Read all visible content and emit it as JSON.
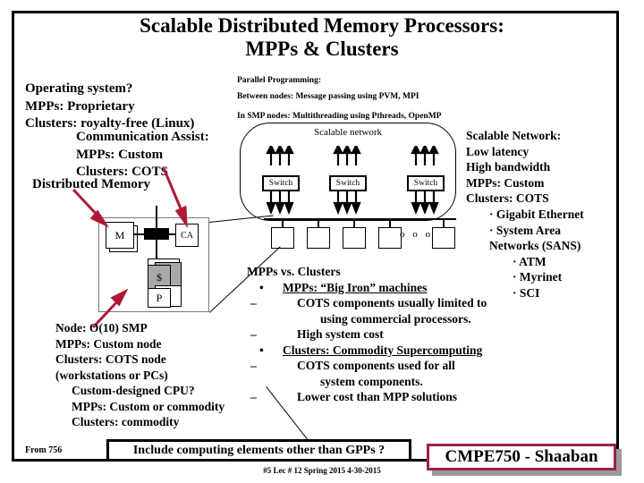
{
  "slide": {
    "title_line1": "Scalable Distributed Memory Processors:",
    "title_line2": "MPPs & Clusters"
  },
  "os_block": {
    "l1": "Operating system?",
    "l2": "MPPs: Proprietary",
    "l3": "Clusters:  royalty-free (Linux)"
  },
  "comm_assist": {
    "l1": "Communication Assist:",
    "l2": "MPPs:  Custom",
    "l3": "Clusters:  COTS"
  },
  "distributed_memory": {
    "label": "Distributed Memory"
  },
  "parallel_programming": {
    "heading": "Parallel Programming:",
    "between_nodes": "Between nodes: Message passing using PVM, MPI",
    "in_smp_nodes": "In SMP nodes:  Multithreading using Pthreads,  OpenMP"
  },
  "network_diagram": {
    "label": "Scalable network",
    "switch_label": "Switch",
    "switches": [
      "Switch",
      "Switch",
      "Switch"
    ],
    "ellipsis": "o  o  o"
  },
  "node_diagram": {
    "memory": "M",
    "comm_assist": "CA",
    "cache": "$",
    "processor": "P"
  },
  "scalable_network_block": {
    "l1": "Scalable Network:",
    "l2": "Low latency",
    "l3": "High bandwidth",
    "l4": "MPPs:  Custom",
    "l5": "Clusters:  COTS",
    "l6": "· Gigabit Ethernet",
    "l7": "· System Area",
    "l8": "Networks (SANS)",
    "l9": "· ATM",
    "l10": "· Myrinet",
    "l11": "· SCI"
  },
  "node_text": {
    "l1": "Node: O(10) SMP",
    "l2": "MPPs:  Custom node",
    "l3": "Clusters:  COTS node",
    "l4": "(workstations or PCs)"
  },
  "cpu_text": {
    "l1": "Custom-designed CPU?",
    "l2": "MPPs:   Custom or commodity",
    "l3": "Clusters:  commodity"
  },
  "mpps_vs_clusters": {
    "heading": "MPPs  vs.  Clusters",
    "bullet1": "MPPs:  “Big Iron” machines",
    "b1_sub1_a": "COTS components usually limited to",
    "b1_sub1_b": "using commercial processors.",
    "b1_sub2": "High system cost",
    "bullet2": "Clusters:  Commodity Supercomputing",
    "b2_sub1_a": "COTS components used for  all",
    "b2_sub1_b": "system components.",
    "b2_sub2": "Lower cost than MPP solutions",
    "bullet_glyph": "•",
    "dash_glyph": "–"
  },
  "bottom_box": {
    "text": "Include computing elements other than GPPs ?"
  },
  "from_label": {
    "text": "From 756"
  },
  "badge": {
    "text": "CMPE750 - Shaaban"
  },
  "footer": {
    "text": "#5  Lec # 12   Spring 2015  4-30-2015"
  },
  "colors": {
    "arrow_red": "#b01838",
    "badge_border": "#9c2244",
    "frame": "#000000",
    "cache_gray": "#a8a8a8"
  }
}
